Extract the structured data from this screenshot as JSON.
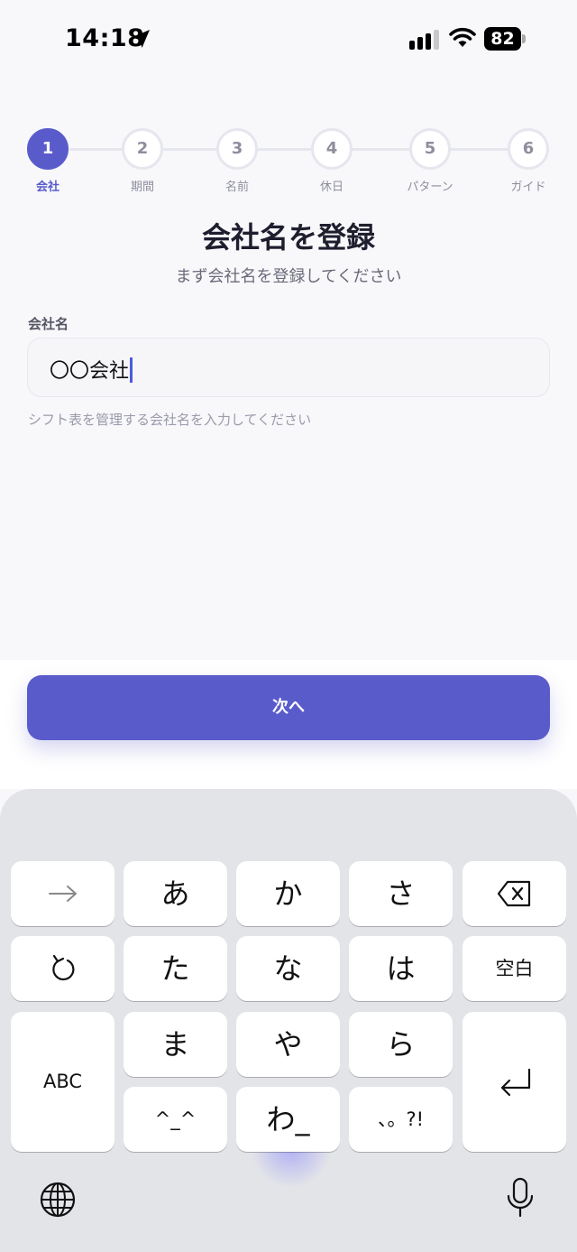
{
  "status_bar": {
    "time": "14:18",
    "battery": "82",
    "icons": [
      "location-arrow-icon",
      "cellular-signal-icon",
      "wifi-icon",
      "battery-icon"
    ]
  },
  "colors": {
    "accent": "#5a5bcb",
    "background": "#f8f8fb",
    "keyboard_bg": "#e3e4e8",
    "caret": "#4a5bdc"
  },
  "stepper": {
    "steps": [
      {
        "number": "1",
        "label": "会社",
        "active": true
      },
      {
        "number": "2",
        "label": "期間",
        "active": false
      },
      {
        "number": "3",
        "label": "名前",
        "active": false
      },
      {
        "number": "4",
        "label": "休日",
        "active": false
      },
      {
        "number": "5",
        "label": "パターン",
        "active": false
      },
      {
        "number": "6",
        "label": "ガイド",
        "active": false
      }
    ]
  },
  "form": {
    "title": "会社名を登録",
    "subtitle": "まず会社名を登録してください",
    "field_label": "会社名",
    "field_value": "〇〇会社",
    "hint": "シフト表を管理する会社名を入力してください"
  },
  "actions": {
    "next_label": "次へ"
  },
  "keyboard": {
    "keys": {
      "a": "あ",
      "ka": "か",
      "sa": "さ",
      "ta": "た",
      "na": "な",
      "ha": "は",
      "ma": "ま",
      "ya": "や",
      "ra": "ら",
      "kaomoji": "^_^",
      "wa": "わ_",
      "punct": "、。?!",
      "space": "空白",
      "abc": "ABC"
    },
    "icons": [
      "arrow-right-icon",
      "backspace-icon",
      "undo-icon",
      "return-icon",
      "globe-icon",
      "microphone-icon"
    ]
  }
}
